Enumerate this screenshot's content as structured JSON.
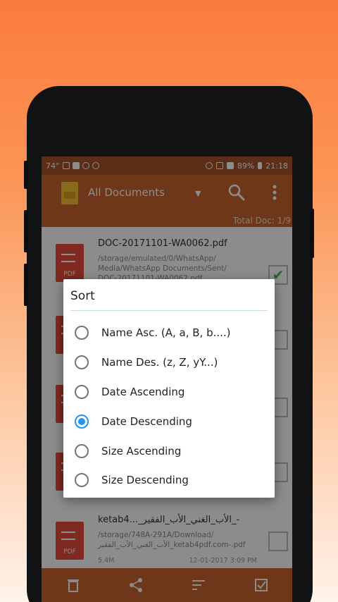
{
  "status_bar": {
    "left_text": "74°",
    "battery": "89%",
    "time": "21:18"
  },
  "toolbar": {
    "doc_type": "All Documents",
    "total_docs": "Total Doc: 1/9"
  },
  "documents": [
    {
      "title": "DOC-20171101-WA0062.pdf",
      "path": "/storage/emulated/0/WhatsApp/ Media/WhatsApp Documents/Sent/ DOC-20171101-WA0062.pdf",
      "icon_label": "PDF",
      "checked": true
    },
    {
      "title": "ketab4..._الأب_الغني_الأب_الفقير_-",
      "path": "/storage/748A-291A/Download/الأب_الغني_الأب_الفقير_ketab4pdf.com-.pdf",
      "icon_label": "PDF",
      "size": "5.4M",
      "date": "12-01-2017 3:09 PM",
      "checked": false
    }
  ],
  "sort_dialog": {
    "title": "Sort",
    "options": [
      {
        "label": "Name Asc. (A, a, B, b....)",
        "selected": false
      },
      {
        "label": "Name Des. (z, Z, yY...)",
        "selected": false
      },
      {
        "label": "Date Ascending",
        "selected": false
      },
      {
        "label": "Date Descending",
        "selected": true
      },
      {
        "label": "Size Ascending",
        "selected": false
      },
      {
        "label": "Size Descending",
        "selected": false
      }
    ]
  },
  "colors": {
    "toolbar": "#c8642f",
    "status_bar": "#a9542a",
    "radio_selected": "#2196f3",
    "pdf_icon": "#e74c3c"
  },
  "icons": [
    "app-logo",
    "search-icon",
    "overflow-menu-icon",
    "dropdown-caret-icon",
    "delete-icon",
    "share-icon",
    "sort-icon",
    "select-all-icon",
    "check-icon"
  ]
}
